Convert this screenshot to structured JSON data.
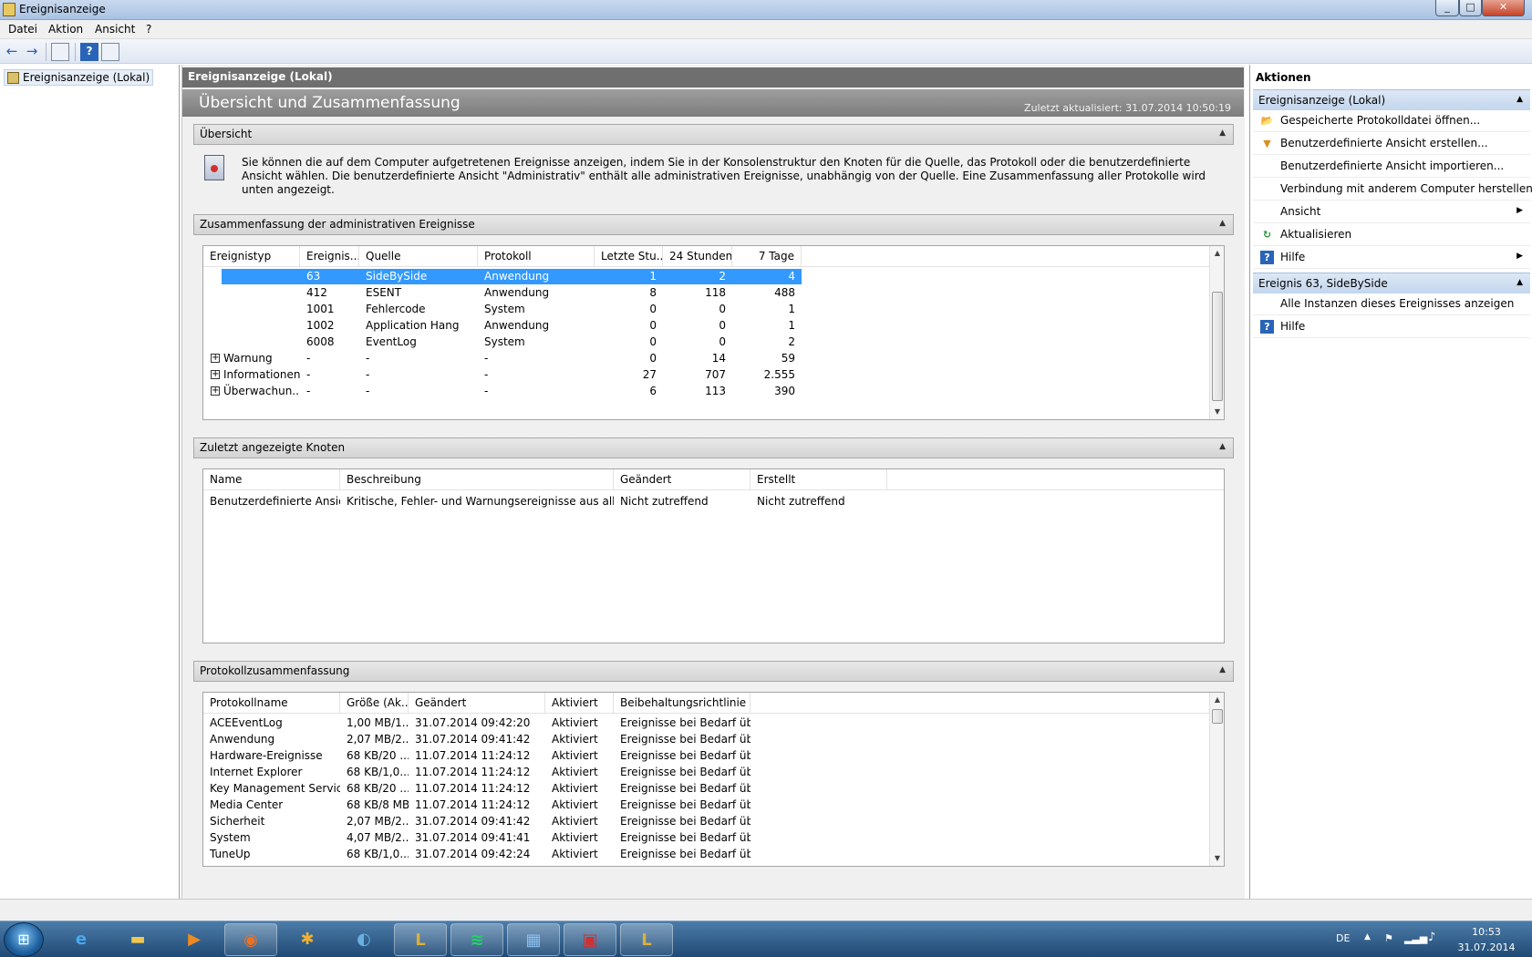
{
  "window": {
    "title": "Ereignisanzeige",
    "controls": [
      "_",
      "□",
      "✕"
    ]
  },
  "menu": [
    "Datei",
    "Aktion",
    "Ansicht",
    "?"
  ],
  "toolbar": {
    "back_icon": "←",
    "forward_icon": "→",
    "help_icon": "?"
  },
  "tree": {
    "root": "Ereignisanzeige (Lokal)"
  },
  "center": {
    "header": "Ereignisanzeige (Lokal)",
    "banner_title": "Übersicht und Zusammenfassung",
    "banner_updated": "Zuletzt aktualisiert: 31.07.2014 10:50:19",
    "overview": {
      "title": "Übersicht",
      "text": "Sie können die auf dem Computer aufgetretenen Ereignisse anzeigen, indem Sie in der Konsolenstruktur den Knoten für die Quelle, das Protokoll oder die benutzerdefinierte Ansicht wählen. Die benutzerdefinierte Ansicht \"Administrativ\" enthält alle administrativen Ereignisse, unabhängig von der Quelle. Eine Zusammenfassung aller Protokolle wird unten angezeigt."
    },
    "admin_summary": {
      "title": "Zusammenfassung der administrativen Ereignisse",
      "columns": [
        "Ereignistyp",
        "Ereignis...",
        "Quelle",
        "Protokoll",
        "Letzte Stu...",
        "24 Stunden",
        "7 Tage"
      ],
      "rows": [
        {
          "type": "",
          "id": "63",
          "source": "SideBySide",
          "log": "Anwendung",
          "hour": "1",
          "day": "2",
          "week": "4",
          "selected": true,
          "expander": false
        },
        {
          "type": "",
          "id": "412",
          "source": "ESENT",
          "log": "Anwendung",
          "hour": "8",
          "day": "118",
          "week": "488",
          "selected": false,
          "expander": false
        },
        {
          "type": "",
          "id": "1001",
          "source": "Fehlercode",
          "log": "System",
          "hour": "0",
          "day": "0",
          "week": "1",
          "selected": false,
          "expander": false
        },
        {
          "type": "",
          "id": "1002",
          "source": "Application Hang",
          "log": "Anwendung",
          "hour": "0",
          "day": "0",
          "week": "1",
          "selected": false,
          "expander": false
        },
        {
          "type": "",
          "id": "6008",
          "source": "EventLog",
          "log": "System",
          "hour": "0",
          "day": "0",
          "week": "2",
          "selected": false,
          "expander": false
        },
        {
          "type": "Warnung",
          "id": "-",
          "source": "-",
          "log": "-",
          "hour": "0",
          "day": "14",
          "week": "59",
          "selected": false,
          "expander": true
        },
        {
          "type": "Informationen",
          "id": "-",
          "source": "-",
          "log": "-",
          "hour": "27",
          "day": "707",
          "week": "2.555",
          "selected": false,
          "expander": true
        },
        {
          "type": "Überwachun...",
          "id": "-",
          "source": "-",
          "log": "-",
          "hour": "6",
          "day": "113",
          "week": "390",
          "selected": false,
          "expander": true
        }
      ]
    },
    "recent_nodes": {
      "title": "Zuletzt angezeigte Knoten",
      "columns": [
        "Name",
        "Beschreibung",
        "Geändert",
        "Erstellt"
      ],
      "rows": [
        {
          "name": "Benutzerdefinierte Ansic...",
          "description": "Kritische, Fehler- und Warnungsereignisse aus allen ...",
          "modified": "Nicht zutreffend",
          "created": "Nicht zutreffend"
        }
      ]
    },
    "log_summary": {
      "title": "Protokollzusammenfassung",
      "columns": [
        "Protokollname",
        "Größe (Ak...",
        "Geändert",
        "Aktiviert",
        "Beibehaltungsrichtlinie"
      ],
      "rows": [
        {
          "name": "ACEEventLog",
          "size": "1,00 MB/1...",
          "modified": "31.07.2014 09:42:20",
          "enabled": "Aktiviert",
          "policy": "Ereignisse bei Bedarf üb..."
        },
        {
          "name": "Anwendung",
          "size": "2,07 MB/2...",
          "modified": "31.07.2014 09:41:42",
          "enabled": "Aktiviert",
          "policy": "Ereignisse bei Bedarf üb..."
        },
        {
          "name": "Hardware-Ereignisse",
          "size": "68 KB/20 ...",
          "modified": "11.07.2014 11:24:12",
          "enabled": "Aktiviert",
          "policy": "Ereignisse bei Bedarf üb..."
        },
        {
          "name": "Internet Explorer",
          "size": "68 KB/1,0...",
          "modified": "11.07.2014 11:24:12",
          "enabled": "Aktiviert",
          "policy": "Ereignisse bei Bedarf üb..."
        },
        {
          "name": "Key Management Service",
          "size": "68 KB/20 ...",
          "modified": "11.07.2014 11:24:12",
          "enabled": "Aktiviert",
          "policy": "Ereignisse bei Bedarf üb..."
        },
        {
          "name": "Media Center",
          "size": "68 KB/8 MB",
          "modified": "11.07.2014 11:24:12",
          "enabled": "Aktiviert",
          "policy": "Ereignisse bei Bedarf üb..."
        },
        {
          "name": "Sicherheit",
          "size": "2,07 MB/2...",
          "modified": "31.07.2014 09:41:42",
          "enabled": "Aktiviert",
          "policy": "Ereignisse bei Bedarf üb..."
        },
        {
          "name": "System",
          "size": "4,07 MB/2...",
          "modified": "31.07.2014 09:41:41",
          "enabled": "Aktiviert",
          "policy": "Ereignisse bei Bedarf üb..."
        },
        {
          "name": "TuneUp",
          "size": "68 KB/1,0...",
          "modified": "31.07.2014 09:42:24",
          "enabled": "Aktiviert",
          "policy": "Ereignisse bei Bedarf üb..."
        }
      ]
    }
  },
  "actions": {
    "title": "Aktionen",
    "group1": {
      "title": "Ereignisanzeige (Lokal)",
      "items": [
        {
          "label": "Gespeicherte Protokolldatei öffnen...",
          "icon": "folder-open-icon",
          "submenu": false
        },
        {
          "label": "Benutzerdefinierte Ansicht erstellen...",
          "icon": "filter-icon",
          "submenu": false
        },
        {
          "label": "Benutzerdefinierte Ansicht importieren...",
          "icon": "",
          "submenu": false
        },
        {
          "label": "Verbindung mit anderem Computer herstellen...",
          "icon": "",
          "submenu": false
        },
        {
          "label": "Ansicht",
          "icon": "",
          "submenu": true
        },
        {
          "label": "Aktualisieren",
          "icon": "refresh-icon",
          "submenu": false
        },
        {
          "label": "Hilfe",
          "icon": "help-icon",
          "submenu": true
        }
      ]
    },
    "group2": {
      "title": "Ereignis 63, SideBySide",
      "items": [
        {
          "label": "Alle Instanzen dieses Ereignisses anzeigen",
          "icon": "",
          "submenu": false
        },
        {
          "label": "Hilfe",
          "icon": "help-icon",
          "submenu": false
        }
      ]
    }
  },
  "taskbar": {
    "apps": [
      "internet-explorer-icon",
      "explorer-icon",
      "media-player-icon",
      "firefox-icon",
      "tool-icon",
      "audio-icon",
      "league-icon",
      "spotify-icon",
      "control-panel-icon",
      "toolbox-icon",
      "league-icon"
    ],
    "language": "DE",
    "time": "10:53",
    "date": "31.07.2014"
  }
}
